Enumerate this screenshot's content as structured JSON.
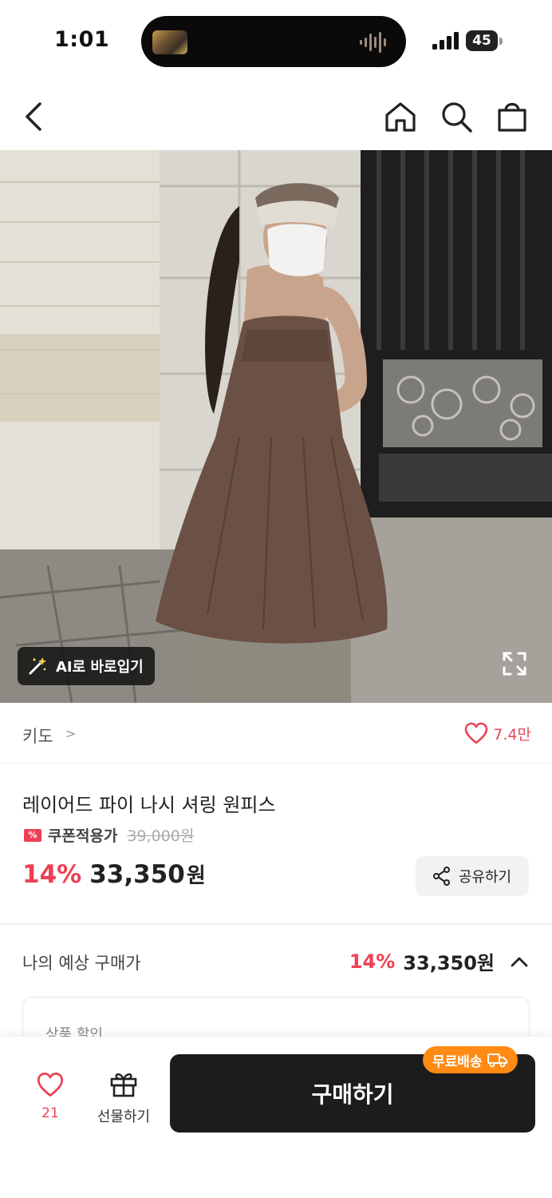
{
  "status_bar": {
    "time": "1:01",
    "battery": "45"
  },
  "nav": {
    "back_icon": "chevron-left-icon",
    "home_icon": "home-icon",
    "search_icon": "search-icon",
    "cart_icon": "shopping-bag-icon"
  },
  "hero": {
    "ai_button_label": "AI로 바로입기",
    "ai_icon": "magic-wand-icon",
    "expand_icon": "expand-icon"
  },
  "brand": {
    "name": "키도",
    "chevron": ">",
    "like_count": "7.4만"
  },
  "product": {
    "title": "레이어드 파이 나시 셔링 원피스",
    "coupon_label": "쿠폰적용가",
    "original_price": "39,000원",
    "discount": "14%",
    "price": "33,350",
    "price_unit": "원",
    "share_label": "공유하기"
  },
  "expected": {
    "label": "나의 예상 구매가",
    "discount": "14%",
    "price": "33,350원"
  },
  "discount_card": {
    "title": "상품 할인"
  },
  "bottom_bar": {
    "wish_count": "21",
    "gift_label": "선물하기",
    "buy_label": "구매하기",
    "free_shipping_label": "무료배송"
  },
  "colors": {
    "accent_red": "#ee4055",
    "free_ship_orange": "#ff8a14",
    "buy_button": "#1c1c1c"
  }
}
